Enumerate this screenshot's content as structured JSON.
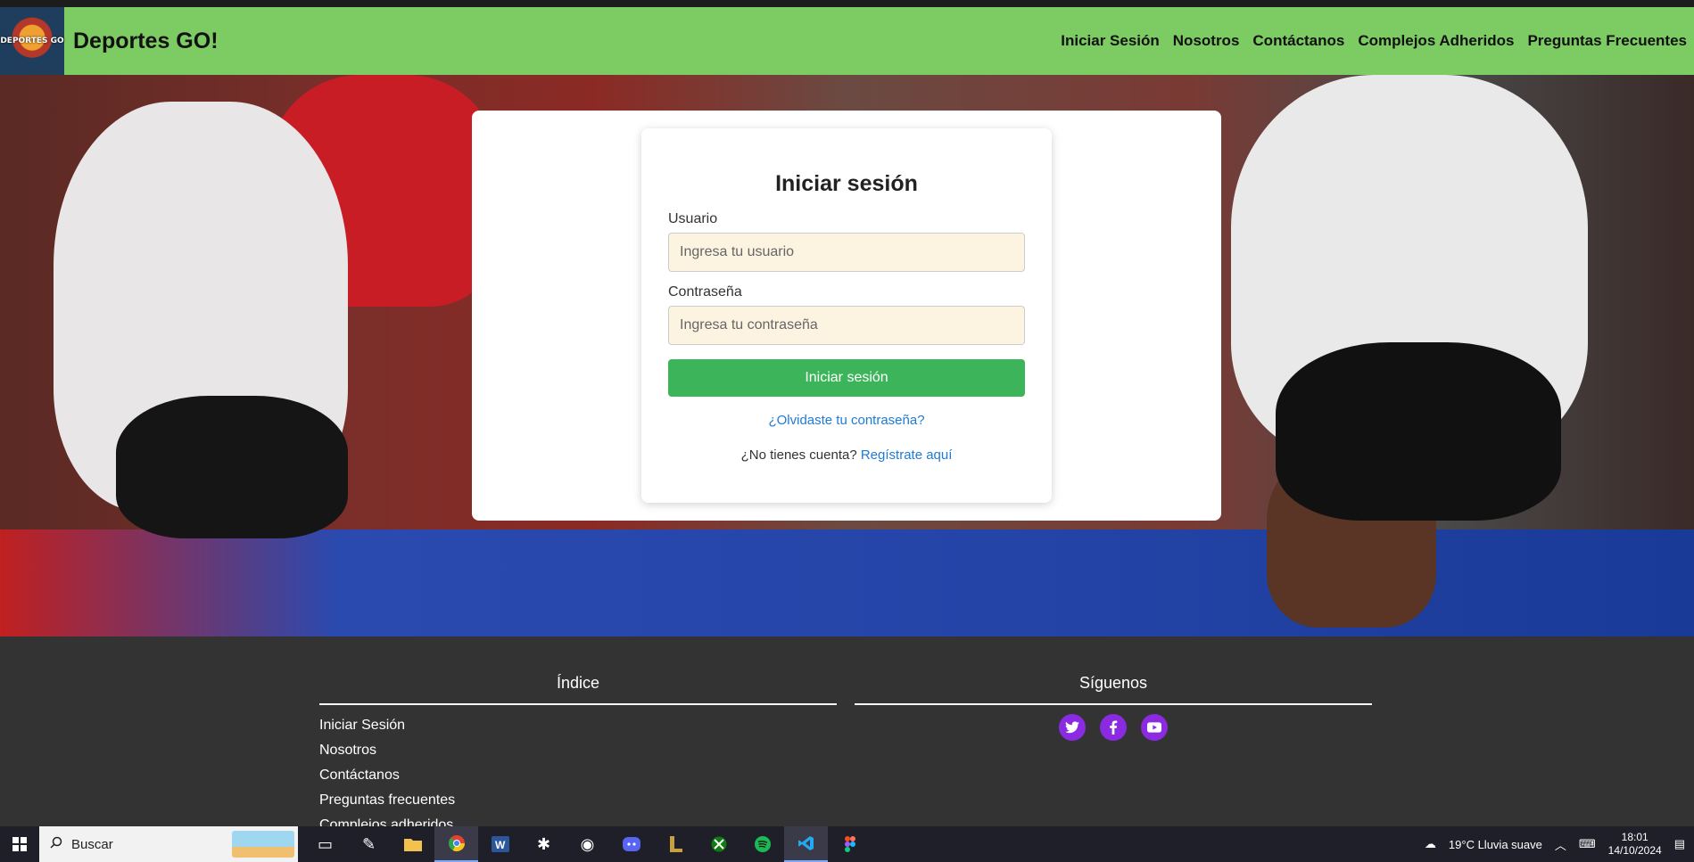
{
  "navbar": {
    "logo_text": "DEPORTES GO",
    "brand": "Deportes GO!",
    "links": [
      "Iniciar Sesión",
      "Nosotros",
      "Contáctanos",
      "Complejos Adheridos",
      "Preguntas Frecuentes"
    ]
  },
  "login": {
    "title": "Iniciar sesión",
    "user_label": "Usuario",
    "user_placeholder": "Ingresa tu usuario",
    "password_label": "Contraseña",
    "password_placeholder": "Ingresa tu contraseña",
    "submit_label": "Iniciar sesión",
    "forgot_link": "¿Olvidaste tu contraseña?",
    "register_prompt": "¿No tienes cuenta?",
    "register_link": "Regístrate aquí"
  },
  "footer": {
    "index_title": "Índice",
    "index_links": [
      "Iniciar Sesión",
      "Nosotros",
      "Contáctanos",
      "Preguntas frecuentes",
      "Complejos adheridos"
    ],
    "follow_title": "Síguenos",
    "socials": [
      "twitter-icon",
      "facebook-icon",
      "youtube-icon"
    ]
  },
  "colors": {
    "navbar": "#7ccb63",
    "login_button": "#3cb55a",
    "link": "#1e7bd6",
    "footer_bg": "#333333",
    "social_icon_bg": "#8a2be2",
    "input_bg": "#fdf3e1"
  },
  "taskbar": {
    "search_placeholder": "Buscar",
    "weather": "19°C  Lluvia suave",
    "time": "18:01",
    "date": "14/10/2024"
  }
}
